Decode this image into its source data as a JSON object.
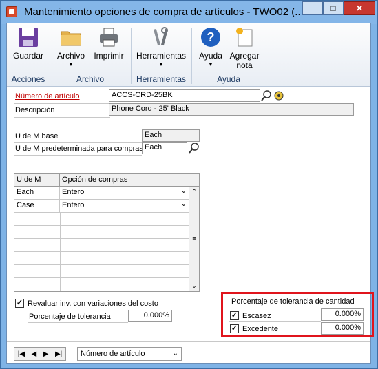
{
  "window": {
    "title": "Mantenimiento opciones de compra de artículos  -  TWO02 (...",
    "controls": {
      "minimize": "_",
      "maximize": "□",
      "close": "✕"
    }
  },
  "ribbon": {
    "buttons": [
      {
        "label": "Guardar",
        "icon": "floppy-disk-icon"
      },
      {
        "label": "Archivo",
        "icon": "folder-icon",
        "dropdown": true
      },
      {
        "label": "Imprimir",
        "icon": "printer-icon"
      },
      {
        "label": "Herramientas",
        "icon": "tools-icon",
        "dropdown": true
      },
      {
        "label": "Ayuda",
        "icon": "help-icon",
        "dropdown": true
      },
      {
        "label": "Agregar",
        "label2": "nota",
        "icon": "add-note-icon"
      }
    ],
    "groups": [
      "Acciones",
      "Archivo",
      "Herramientas",
      "Ayuda"
    ]
  },
  "item": {
    "number_label": "Número de artículo",
    "number_value": "ACCS-CRD-25BK",
    "description_label": "Descripción",
    "description_value": "Phone Cord - 25' Black"
  },
  "uom": {
    "base_label": "U de M base",
    "base_value": "Each",
    "default_label": "U de M predeterminada para compras",
    "default_value": "Each"
  },
  "grid": {
    "headers": [
      "U de M",
      "Opción de compras"
    ],
    "rows": [
      {
        "uom": "Each",
        "option": "Entero"
      },
      {
        "uom": "Case",
        "option": "Entero"
      }
    ]
  },
  "revalue": {
    "label": "Revaluar inv. con variaciones del costo",
    "checked": true,
    "tolerance_label": "Porcentaje de tolerancia",
    "tolerance_value": "0.000%"
  },
  "qty_tolerance": {
    "title": "Porcentaje de tolerancia de cantidad",
    "shortage_label": "Escasez",
    "shortage_value": "0.000%",
    "shortage_checked": true,
    "excess_label": "Excedente",
    "excess_value": "0.000%",
    "excess_checked": true,
    "highlight_color": "#e0141c"
  },
  "navigation": {
    "sort_by": "Número de artículo"
  }
}
